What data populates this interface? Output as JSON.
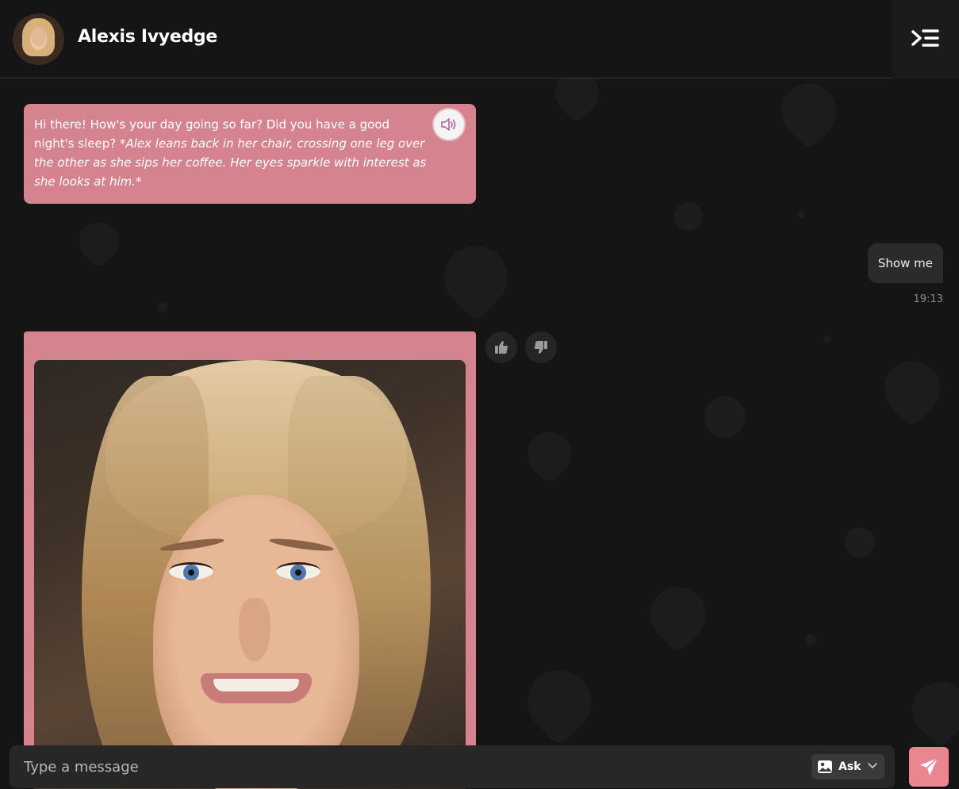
{
  "header": {
    "contact_name": "Alexis Ivyedge",
    "avatar_icon": "profile-photo",
    "menu_icon": "collapse-menu-icon"
  },
  "messages": [
    {
      "role": "bot",
      "text": "Hi there! How's your day going so far? Did you have a good night's sleep?",
      "action_text": "*Alex leans back in her chair, crossing one leg over the other as she sips her coffee. Her eyes sparkle with interest as she looks at him.*",
      "speaker_icon": "speaker-icon"
    },
    {
      "role": "user",
      "text": "Show me",
      "time": "19:13"
    },
    {
      "role": "bot",
      "type": "image",
      "image_icon": "portrait-photo",
      "reactions": [
        "thumbs-up-icon",
        "thumbs-down-icon"
      ]
    }
  ],
  "composer": {
    "placeholder": "Type a message",
    "value": "",
    "ask_label": "Ask",
    "ask_icon": "image-icon",
    "send_icon": "send-icon"
  },
  "colors": {
    "accent": "#d5848f",
    "send_button": "#e9868f",
    "background": "#151515",
    "user_bubble": "#2b2b2b"
  }
}
